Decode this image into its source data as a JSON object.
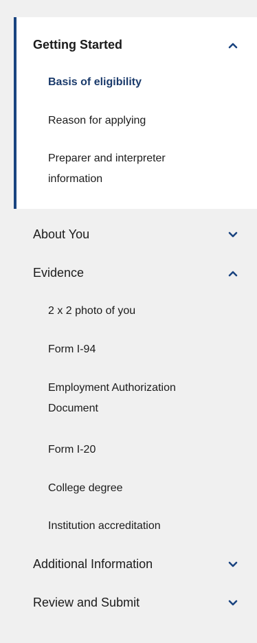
{
  "nav": {
    "sections": [
      {
        "label": "Getting Started",
        "expanded": true,
        "items": [
          "Basis of eligibility",
          "Reason for applying",
          "Preparer and interpreter information"
        ]
      },
      {
        "label": "About You",
        "expanded": false
      },
      {
        "label": "Evidence",
        "expanded": true,
        "items": [
          "2 x 2 photo of you",
          "Form I-94",
          "Employment Authorization Document",
          "Form I-20",
          "College degree",
          "Institution accreditation"
        ]
      },
      {
        "label": "Additional Information",
        "expanded": false
      },
      {
        "label": "Review and Submit",
        "expanded": false
      }
    ],
    "current_item": "Basis of eligibility",
    "colors": {
      "accent": "#1a4480",
      "chevron": "#1a4480",
      "background": "#f0f0f0",
      "active_background": "#ffffff"
    },
    "icons": {
      "expanded": "chevron-up-icon",
      "collapsed": "chevron-down-icon"
    }
  }
}
